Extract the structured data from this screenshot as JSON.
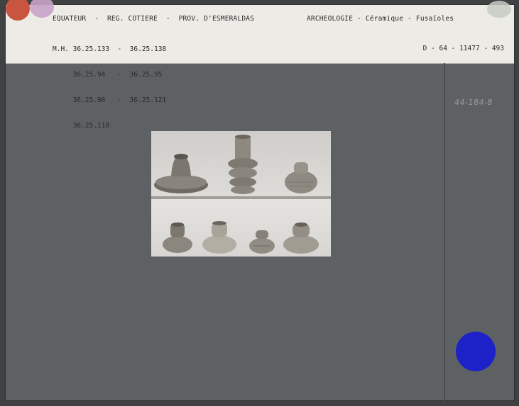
{
  "header": {
    "left": "EQUATEUR  -  REG. COTIERE  -  PROV. D'ESMERALDAS",
    "right": "ARCHEOLOGIE - Céramique - Fusaïoles"
  },
  "inventory": {
    "lines": [
      "M.H. 36.25.133  -  36.25.138",
      "     36.25.94   -  36.25.95",
      "     36.25.90   -  36.25.121",
      "     36.25.110"
    ]
  },
  "doc_number": "D - 64 - 11477 - 493",
  "pencil_note": "44-184-8",
  "photo": {
    "subject": "Fusaïoles en céramique",
    "top_row": [
      "spindle-whorl-flat",
      "spindle-whorl-stacked",
      "spindle-whorl-round"
    ],
    "bottom_row": [
      "spindle-whorl-1",
      "spindle-whorl-2",
      "spindle-whorl-3",
      "spindle-whorl-4"
    ]
  },
  "colors": {
    "card": "#5e6163",
    "label": "#ecebe6",
    "blue_marker": "#1d22c8",
    "red_marker": "#c9543f",
    "pink_marker": "#c9a3c9"
  }
}
